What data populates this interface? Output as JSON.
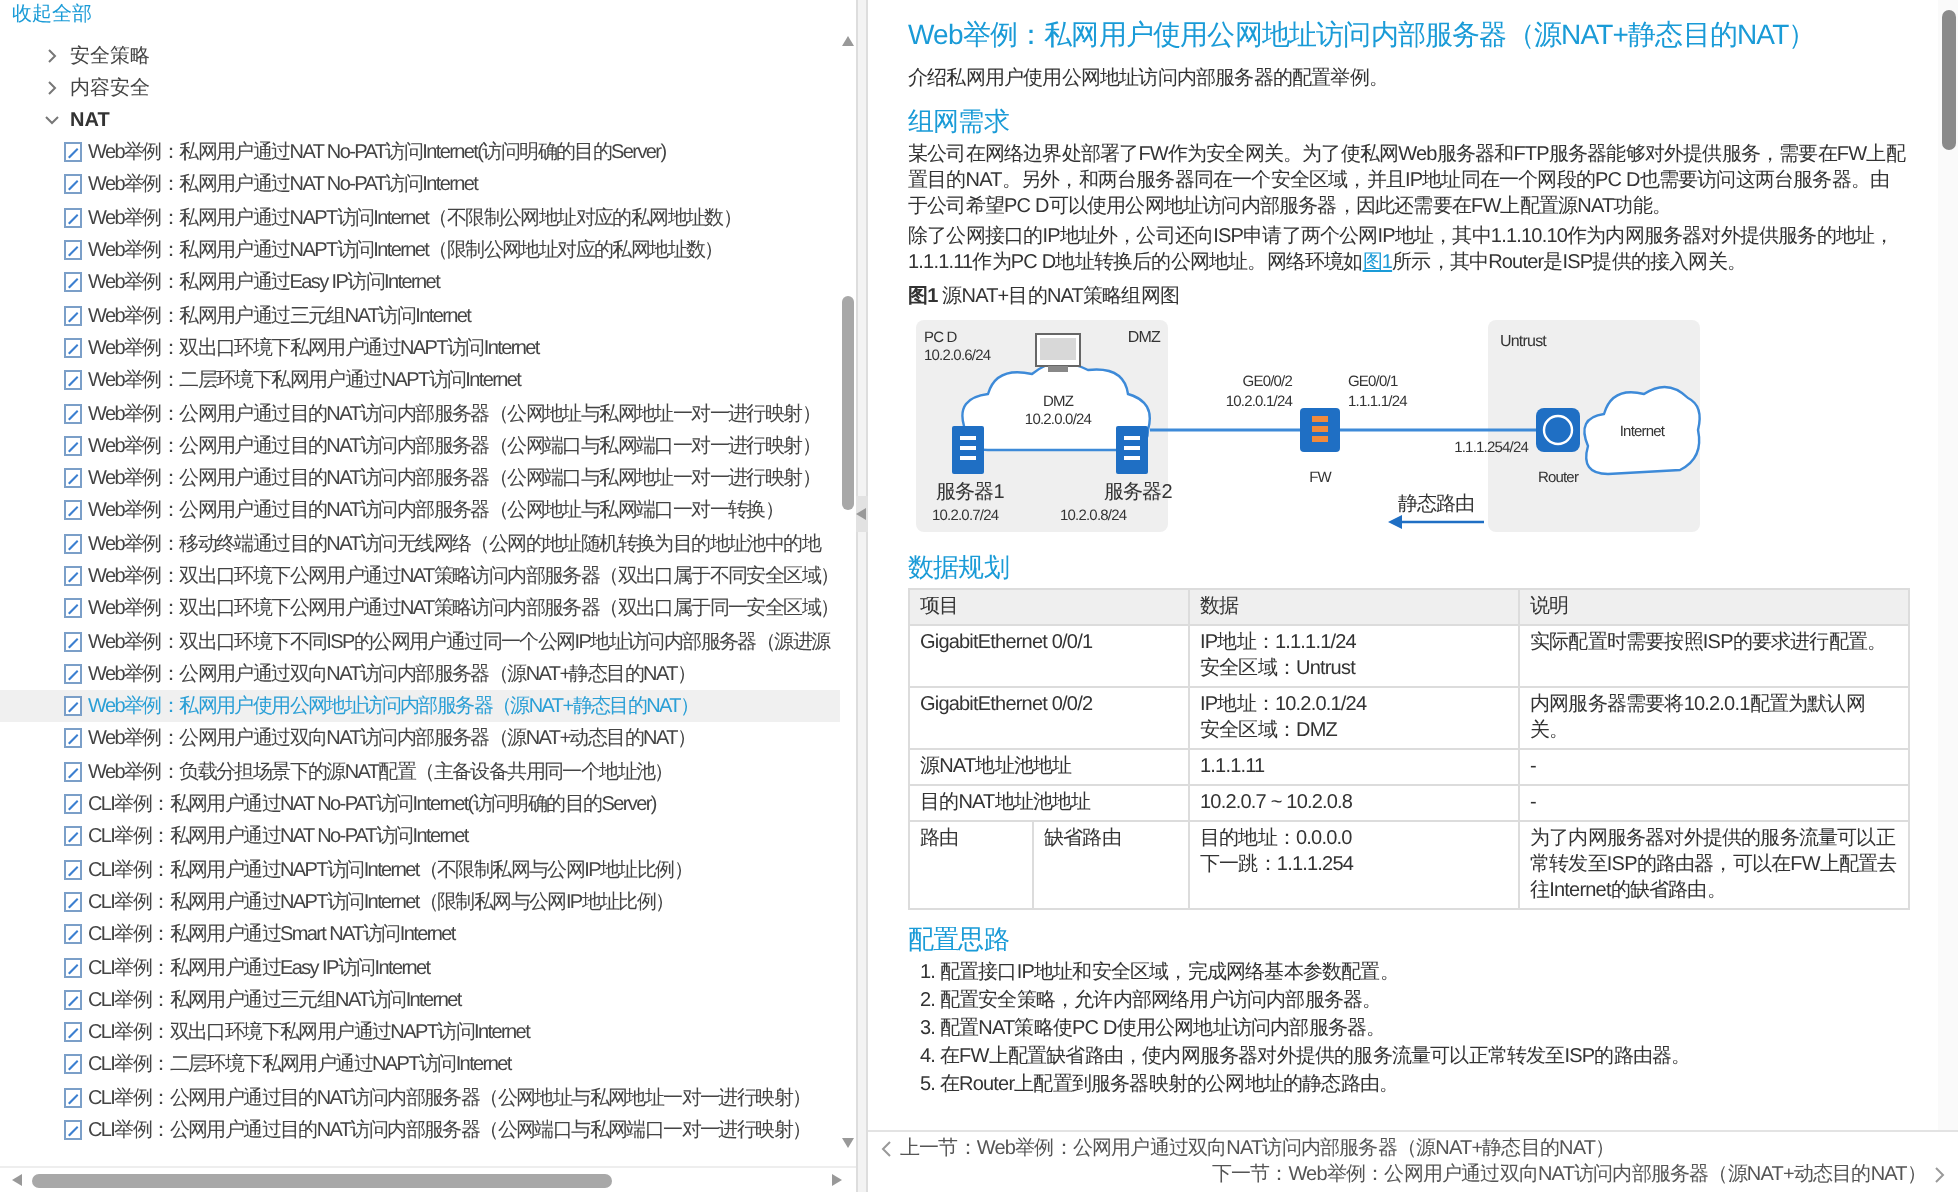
{
  "sidebar": {
    "collapse_all": "收起全部",
    "items": [
      {
        "label": "安全策略",
        "expanded": false
      },
      {
        "label": "内容安全",
        "expanded": false
      },
      {
        "label": "NAT",
        "expanded": true,
        "children": [
          {
            "label": "Web举例：私网用户通过NAT No-PAT访问Internet(访问明确的目的Server)",
            "selected": false
          },
          {
            "label": "Web举例：私网用户通过NAT No-PAT访问Internet",
            "selected": false
          },
          {
            "label": "Web举例：私网用户通过NAPT访问Internet（不限制公网地址对应的私网地址数）",
            "selected": false
          },
          {
            "label": "Web举例：私网用户通过NAPT访问Internet（限制公网地址对应的私网地址数）",
            "selected": false
          },
          {
            "label": "Web举例：私网用户通过Easy IP访问Internet",
            "selected": false
          },
          {
            "label": "Web举例：私网用户通过三元组NAT访问Internet",
            "selected": false
          },
          {
            "label": "Web举例：双出口环境下私网用户通过NAPT访问Internet",
            "selected": false
          },
          {
            "label": "Web举例：二层环境下私网用户通过NAPT访问Internet",
            "selected": false
          },
          {
            "label": "Web举例：公网用户通过目的NAT访问内部服务器（公网地址与私网地址一对一进行映射）",
            "selected": false
          },
          {
            "label": "Web举例：公网用户通过目的NAT访问内部服务器（公网端口与私网端口一对一进行映射）",
            "selected": false
          },
          {
            "label": "Web举例：公网用户通过目的NAT访问内部服务器（公网端口与私网地址一对一进行映射）",
            "selected": false
          },
          {
            "label": "Web举例：公网用户通过目的NAT访问内部服务器（公网地址与私网端口一对一转换）",
            "selected": false
          },
          {
            "label": "Web举例：移动终端通过目的NAT访问无线网络（公网的地址随机转换为目的地址池中的地",
            "selected": false
          },
          {
            "label": "Web举例：双出口环境下公网用户通过NAT策略访问内部服务器（双出口属于不同安全区域）",
            "selected": false
          },
          {
            "label": "Web举例：双出口环境下公网用户通过NAT策略访问内部服务器（双出口属于同一安全区域）",
            "selected": false
          },
          {
            "label": "Web举例：双出口环境下不同ISP的公网用户通过同一个公网IP地址访问内部服务器（源进源",
            "selected": false
          },
          {
            "label": "Web举例：公网用户通过双向NAT访问内部服务器（源NAT+静态目的NAT）",
            "selected": false
          },
          {
            "label": "Web举例：私网用户使用公网地址访问内部服务器（源NAT+静态目的NAT）",
            "selected": true
          },
          {
            "label": "Web举例：公网用户通过双向NAT访问内部服务器（源NAT+动态目的NAT）",
            "selected": false
          },
          {
            "label": "Web举例：负载分担场景下的源NAT配置（主备设备共用同一个地址池）",
            "selected": false
          },
          {
            "label": "CLI举例：私网用户通过NAT No-PAT访问Internet(访问明确的目的Server)",
            "selected": false
          },
          {
            "label": "CLI举例：私网用户通过NAT No-PAT访问Internet",
            "selected": false
          },
          {
            "label": "CLI举例：私网用户通过NAPT访问Internet（不限制私网与公网IP地址比例）",
            "selected": false
          },
          {
            "label": "CLI举例：私网用户通过NAPT访问Internet（限制私网与公网IP地址比例）",
            "selected": false
          },
          {
            "label": "CLI举例：私网用户通过Smart NAT访问Internet",
            "selected": false
          },
          {
            "label": "CLI举例：私网用户通过Easy IP访问Internet",
            "selected": false
          },
          {
            "label": "CLI举例：私网用户通过三元组NAT访问Internet",
            "selected": false
          },
          {
            "label": "CLI举例：双出口环境下私网用户通过NAPT访问Internet",
            "selected": false
          },
          {
            "label": "CLI举例：二层环境下私网用户通过NAPT访问Internet",
            "selected": false
          },
          {
            "label": "CLI举例：公网用户通过目的NAT访问内部服务器（公网地址与私网地址一对一进行映射）",
            "selected": false
          },
          {
            "label": "CLI举例：公网用户通过目的NAT访问内部服务器（公网端口与私网端口一对一进行映射）",
            "selected": false
          }
        ]
      }
    ]
  },
  "article": {
    "title": "Web举例：私网用户使用公网地址访问内部服务器（源NAT+静态目的NAT）",
    "intro": "介绍私网用户使用公网地址访问内部服务器的配置举例。",
    "networking": {
      "heading": "组网需求",
      "paragraph_1": "某公司在网络边界处部署了FW作为安全网关。为了使私网Web服务器和FTP服务器能够对外提供服务，需要在FW上配置目的NAT。另外，和两台服务器同在一个安全区域，并且IP地址同在一个网段的PC D也需要访问这两台服务器。由于公司希望PC D可以使用公网地址访问内部服务器，因此还需要在FW上配置源NAT功能。",
      "paragraph_2": {
        "text": "除了公网接口的IP地址外，公司还向ISP申请了两个公网IP地址，其中1.1.10.10作为内网服务器对外提供服务的地址，1.1.1.11作为PC D地址转换后的公网地址。网络环境如",
        "link": "图1",
        "after": "所示，其中Router是ISP提供的接入网关。"
      },
      "figure": {
        "caption": "**图1** 源NAT+目的NAT策略组网图",
        "dmz_zone": "DMZ",
        "pc_name": "PC D",
        "pc_ip": "10.2.0.6/24",
        "dmz_cloud": "DMZ",
        "dmz_subnet": "10.2.0.0/24",
        "server_1": "服务器1",
        "server_1_ip": "10.2.0.7/24",
        "server_2": "服务器2",
        "server_2_ip": "10.2.0.8/24",
        "fw_port_dmz": "GE0/0/2",
        "fw_ip_dmz": "10.2.0.1/24",
        "fw_port_untrust": "GE0/0/1",
        "fw_ip_untrust": "1.1.1.1/24",
        "router_ip": "1.1.1.254/24",
        "fw_name": "FW",
        "untrust_zone": "Untrust",
        "internet": "Internet",
        "router_name": "Router",
        "static_route": "静态路由"
      }
    },
    "data_plan": {
      "heading": "数据规划",
      "columns": [
        "项目",
        "数据",
        "说明"
      ],
      "rows": [
        {
          "item": [
            "GigabitEthernet 0/0/1"
          ],
          "data": [
            "IP地址：1.1.1.1/24",
            "安全区域：Untrust"
          ],
          "note": "实际配置时需要按照ISP的要求进行配置。"
        },
        {
          "item": [
            "GigabitEthernet 0/0/2"
          ],
          "data": [
            "IP地址：10.2.0.1/24",
            "安全区域：DMZ"
          ],
          "note": "内网服务器需要将10.2.0.1配置为默认网关。"
        },
        {
          "item": [
            "源NAT地址池地址"
          ],
          "data": [
            "1.1.1.11"
          ],
          "note": "-"
        },
        {
          "item": [
            "目的NAT地址池地址"
          ],
          "data": [
            "10.2.0.7 ~ 10.2.0.8"
          ],
          "note": "-"
        },
        {
          "item": [
            "路由",
            "缺省路由"
          ],
          "data": [
            "目的地址：0.0.0.0",
            "下一跳：1.1.1.254"
          ],
          "note": "为了内网服务器对外提供的服务流量可以正常转发至ISP的路由器，可以在FW上配置去往Internet的缺省路由。"
        }
      ]
    },
    "approach": {
      "heading": "配置思路",
      "steps": [
        "1. 配置接口IP地址和安全区域，完成网络基本参数配置。",
        "2. 配置安全策略，允许内部网络用户访问内部服务器。",
        "3. 配置NAT策略使PC D使用公网地址访问内部服务器。",
        "4. 在FW上配置缺省路由，使内网服务器对外提供的服务流量可以正常转发至ISP的路由器。",
        "5. 在Router上配置到服务器映射的公网地址的静态路由。"
      ]
    }
  },
  "pager": {
    "previous": "上一节：Web举例：公网用户通过双向NAT访问内部服务器（源NAT+静态目的NAT）",
    "next": "下一节：Web举例：公网用户通过双向NAT访问内部服务器（源NAT+动态目的NAT）"
  }
}
